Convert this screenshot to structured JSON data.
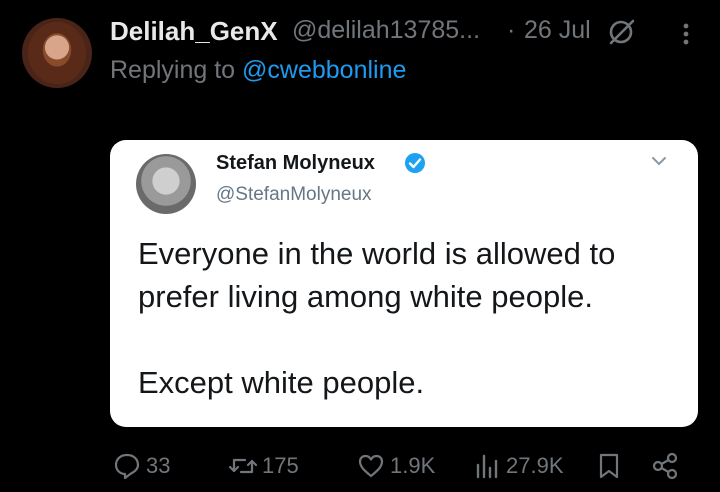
{
  "author": {
    "display_name": "Delilah_GenX",
    "handle": "@delilah13785...",
    "separator": "·",
    "date": "26 Jul"
  },
  "reply": {
    "prefix": "Replying to ",
    "mention": "@cwebbonline"
  },
  "quoted_image": {
    "name": "Stefan Molyneux",
    "handle": "@StefanMolyneux",
    "line1": "Everyone in the world is allowed to",
    "line2": "prefer living among white people.",
    "line3": "Except white people."
  },
  "actions": {
    "replies": "33",
    "reposts": "175",
    "likes": "1.9K",
    "views": "27.9K"
  },
  "colors": {
    "background": "#000000",
    "primary_text": "#e7e9ea",
    "secondary_text": "#71767b",
    "link": "#1d9bf0",
    "verified": "#1da1f2"
  },
  "icons": [
    "grok-icon",
    "more-icon",
    "verified-icon",
    "chevron-down-icon",
    "reply-icon",
    "repost-icon",
    "like-icon",
    "views-icon",
    "bookmark-icon",
    "share-icon"
  ]
}
